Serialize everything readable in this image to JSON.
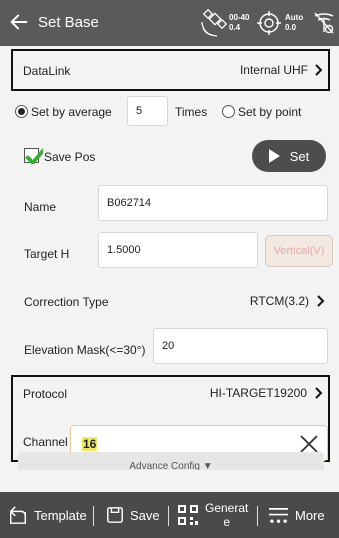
{
  "header": {
    "title": "Set Base",
    "sat_status": {
      "top": "00-40",
      "bottom": "0.4"
    },
    "gps_status": {
      "top": "Auto",
      "bottom": "0.0"
    }
  },
  "datalink": {
    "label": "DataLink",
    "value": "Internal UHF"
  },
  "start_mode": {
    "average_label": "Set by average",
    "average_value": "5",
    "times_label": "Times",
    "point_label": "Set by point",
    "selected": "average"
  },
  "save_pos": {
    "label": "Save Pos",
    "checked": true
  },
  "set_button": {
    "label": "Set"
  },
  "name": {
    "label": "Name",
    "value": "B062714"
  },
  "target_h": {
    "label": "Target H",
    "value": "1.5000",
    "mode_button": "Vertical(V)"
  },
  "correction": {
    "label": "Correction Type",
    "value": "RTCM(3.2)"
  },
  "elevation": {
    "label": "Elevation Mask(<=30°)",
    "value": "20"
  },
  "protocol": {
    "label": "Protocol",
    "value": "HI-TARGET19200"
  },
  "channel": {
    "label": "Channel",
    "value": "16"
  },
  "advance": {
    "label": "Advance Config ▼"
  },
  "toolbar": {
    "template": "Template",
    "save": "Save",
    "generate_line1": "Generat",
    "generate_line2": "e",
    "more": "More"
  },
  "colors": {
    "topbar": "#5a5a5a",
    "bottombar": "#4a4a4a",
    "check_green": "#3aaa35",
    "highlight": "#ebe86a",
    "vertical_text": "#f0a7a7"
  }
}
